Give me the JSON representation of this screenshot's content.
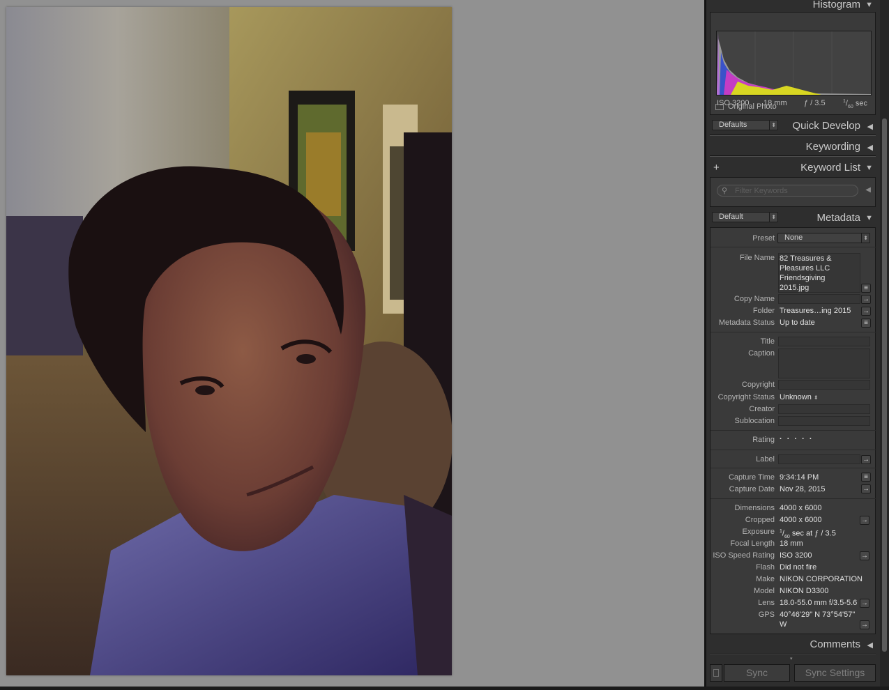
{
  "histogram": {
    "title": "Histogram",
    "iso": "ISO 3200",
    "focal": "18 mm",
    "aperture": "ƒ / 3.5",
    "shutter_num": "1",
    "shutter_den": "60",
    "shutter_unit": "sec",
    "original_photo": "Original Photo"
  },
  "quick_develop": {
    "preset": "Defaults",
    "title": "Quick Develop"
  },
  "keywording": {
    "title": "Keywording"
  },
  "keyword_list": {
    "title": "Keyword List",
    "filter_placeholder": "Filter Keywords"
  },
  "metadata": {
    "view": "Default",
    "title": "Metadata",
    "preset_label": "Preset",
    "preset_value": "None",
    "file_name_label": "File Name",
    "file_name_lines": [
      "82 Treasures &",
      "Pleasures LLC",
      "Friendsgiving",
      "2015.jpg"
    ],
    "copy_name_label": "Copy Name",
    "folder_label": "Folder",
    "folder_value": "Treasures…ing 2015",
    "status_label": "Metadata Status",
    "status_value": "Up to date",
    "title_label": "Title",
    "caption_label": "Caption",
    "copyright_label": "Copyright",
    "copyright_status_label": "Copyright Status",
    "copyright_status_value": "Unknown",
    "creator_label": "Creator",
    "sublocation_label": "Sublocation",
    "rating_label": "Rating",
    "rating_value": "· · · · ·",
    "label_label": "Label",
    "capture_time_label": "Capture Time",
    "capture_time_value": "9:34:14 PM",
    "capture_date_label": "Capture Date",
    "capture_date_value": "Nov 28, 2015",
    "dimensions_label": "Dimensions",
    "dimensions_value": "4000 x 6000",
    "cropped_label": "Cropped",
    "cropped_value": "4000 x 6000",
    "exposure_label": "Exposure",
    "exposure_num": "1",
    "exposure_den": "60",
    "exposure_rest": "sec at ƒ / 3.5",
    "focal_length_label": "Focal Length",
    "focal_length_value": "18 mm",
    "iso_label": "ISO Speed Rating",
    "iso_value": "ISO 3200",
    "flash_label": "Flash",
    "flash_value": "Did not fire",
    "make_label": "Make",
    "make_value": "NIKON CORPORATION",
    "model_label": "Model",
    "model_value": "NIKON D3300",
    "lens_label": "Lens",
    "lens_value": "18.0-55.0 mm f/3.5-5.6",
    "gps_label": "GPS",
    "gps_line1": "40°46'29\" N 73°54'57\"",
    "gps_line2": "W"
  },
  "comments": {
    "title": "Comments"
  },
  "sync": {
    "sync_label": "Sync",
    "sync_settings_label": "Sync Settings"
  },
  "colors": {
    "panel": "#2e2e2e",
    "background": "#919191",
    "panel_section": "#3a3a3a"
  }
}
